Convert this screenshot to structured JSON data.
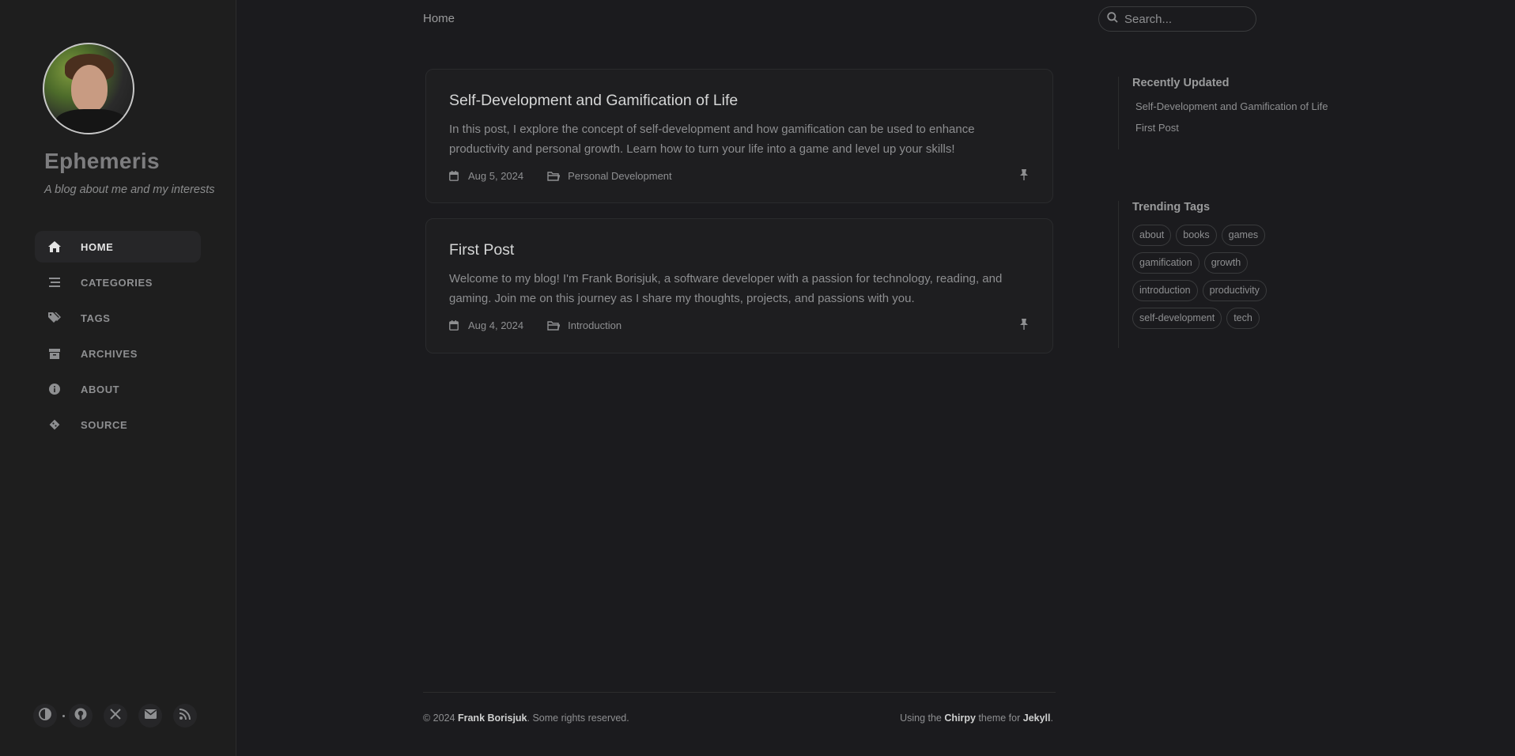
{
  "sidebar": {
    "site_title": "Ephemeris",
    "site_subtitle": "A blog about me and my interests",
    "nav": [
      {
        "label": "HOME",
        "icon": "home-icon",
        "active": true
      },
      {
        "label": "CATEGORIES",
        "icon": "stream-icon"
      },
      {
        "label": "TAGS",
        "icon": "tags-icon"
      },
      {
        "label": "ARCHIVES",
        "icon": "archive-icon"
      },
      {
        "label": "ABOUT",
        "icon": "info-icon"
      },
      {
        "label": "SOURCE",
        "icon": "git-icon"
      }
    ],
    "bottom_icons": [
      "theme-toggle-icon",
      "github-icon",
      "x-twitter-icon",
      "email-icon",
      "rss-icon"
    ]
  },
  "topbar": {
    "breadcrumb": "Home",
    "search_placeholder": "Search..."
  },
  "posts": [
    {
      "title": "Self-Development and Gamification of Life",
      "excerpt": "In this post, I explore the concept of self-development and how gamification can be used to enhance productivity and personal growth. Learn how to turn your life into a game and level up your skills!",
      "date": "Aug 5, 2024",
      "category": "Personal Development",
      "pinned": true
    },
    {
      "title": "First Post",
      "excerpt": "Welcome to my blog! I'm Frank Borisjuk, a software developer with a passion for technology, reading, and gaming. Join me on this journey as I share my thoughts, projects, and passions with you.",
      "date": "Aug 4, 2024",
      "category": "Introduction",
      "pinned": true
    }
  ],
  "panel": {
    "recent_title": "Recently Updated",
    "recent": [
      "Self-Development and Gamification of Life",
      "First Post"
    ],
    "tags_title": "Trending Tags",
    "tags": [
      "about",
      "books",
      "games",
      "gamification",
      "growth",
      "introduction",
      "productivity",
      "self-development",
      "tech"
    ]
  },
  "footer": {
    "copyright_prefix": "© 2024",
    "author": "Frank Borisjuk",
    "rights": ". Some rights reserved.",
    "using": "Using the",
    "theme": "Chirpy",
    "theme_for": "theme for",
    "engine": "Jekyll",
    "end": "."
  },
  "colors": {
    "background": "#1b1b1e",
    "sidebar": "#1e1e1e",
    "card": "#1e1e20",
    "text": "#afb0b1"
  }
}
